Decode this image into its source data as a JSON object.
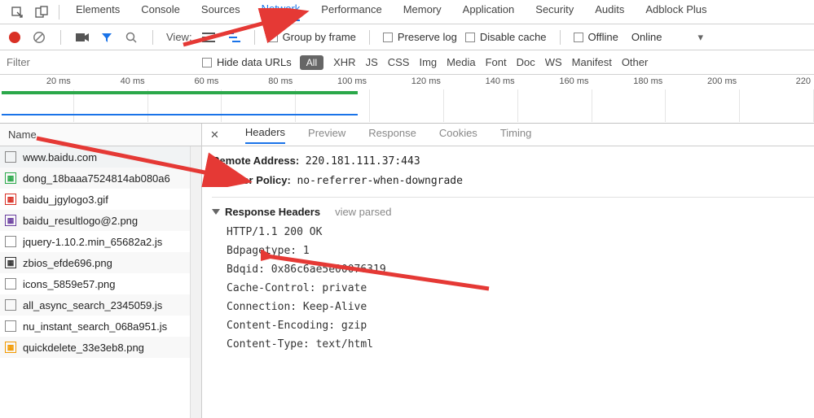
{
  "top_tabs": [
    "Elements",
    "Console",
    "Sources",
    "Network",
    "Performance",
    "Memory",
    "Application",
    "Security",
    "Audits",
    "Adblock Plus"
  ],
  "top_active_index": 3,
  "toolbar2": {
    "view_label": "View:",
    "group_by_frame": "Group by frame",
    "preserve_log": "Preserve log",
    "disable_cache": "Disable cache",
    "offline": "Offline",
    "online": "Online"
  },
  "filterbar": {
    "filter_placeholder": "Filter",
    "hide_data_urls": "Hide data URLs",
    "all": "All",
    "types": [
      "XHR",
      "JS",
      "CSS",
      "Img",
      "Media",
      "Font",
      "Doc",
      "WS",
      "Manifest",
      "Other"
    ]
  },
  "timeline_ticks": [
    "20 ms",
    "40 ms",
    "60 ms",
    "80 ms",
    "100 ms",
    "120 ms",
    "140 ms",
    "160 ms",
    "180 ms",
    "200 ms",
    "220"
  ],
  "name_header": "Name",
  "name_list": [
    {
      "icon": "doc",
      "text": "www.baidu.com",
      "selected": true
    },
    {
      "icon": "img-g",
      "text": "dong_18baaa7524814ab080a6"
    },
    {
      "icon": "img-r",
      "text": "baidu_jgylogo3.gif"
    },
    {
      "icon": "img-p",
      "text": "baidu_resultlogo@2.png"
    },
    {
      "icon": "doc",
      "text": "jquery-1.10.2.min_65682a2.js"
    },
    {
      "icon": "img-b",
      "text": "zbios_efde696.png"
    },
    {
      "icon": "doc",
      "text": "icons_5859e57.png"
    },
    {
      "icon": "doc",
      "text": "all_async_search_2345059.js"
    },
    {
      "icon": "doc",
      "text": "nu_instant_search_068a951.js"
    },
    {
      "icon": "img-o",
      "text": "quickdelete_33e3eb8.png"
    }
  ],
  "details_tabs": [
    "Headers",
    "Preview",
    "Response",
    "Cookies",
    "Timing"
  ],
  "details_active_index": 0,
  "general": {
    "remote_address_k": "Remote Address:",
    "remote_address_v": "220.181.111.37:443",
    "referrer_k": "Referrer Policy:",
    "referrer_v": "no-referrer-when-downgrade"
  },
  "response_headers_title": "Response Headers",
  "view_parsed": "view parsed",
  "response_headers_lines": [
    "HTTP/1.1 200 OK",
    "Bdpagetype: 1",
    "Bdqid: 0x86c6ae5e00076319",
    "Cache-Control: private",
    "Connection: Keep-Alive",
    "Content-Encoding: gzip",
    "Content-Type: text/html"
  ]
}
